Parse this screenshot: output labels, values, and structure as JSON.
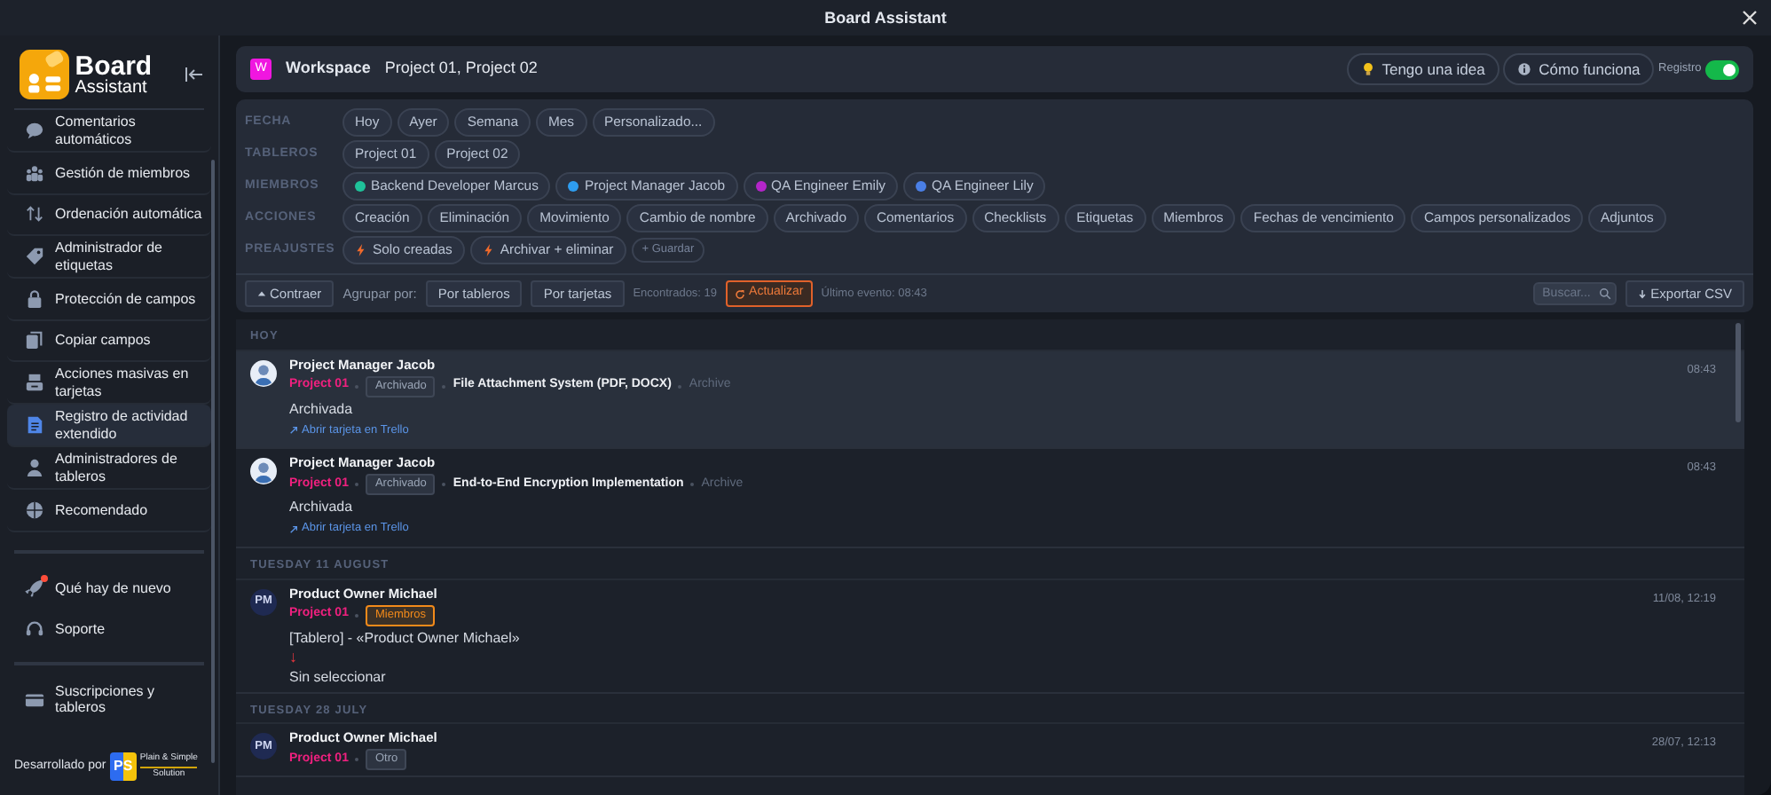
{
  "window": {
    "title": "Board Assistant"
  },
  "sidebar": {
    "logo_title": "Board",
    "logo_subtitle": "Assistant",
    "items": [
      {
        "label": "Comentarios automáticos",
        "selected": false
      },
      {
        "label": "Gestión de miembros",
        "selected": false
      },
      {
        "label": "Ordenación automática",
        "selected": false
      },
      {
        "label": "Administrador de etiquetas",
        "selected": false
      },
      {
        "label": "Protección de campos",
        "selected": false
      },
      {
        "label": "Copiar campos",
        "selected": false
      },
      {
        "label": "Acciones masivas en tarjetas",
        "selected": false
      },
      {
        "label": "Registro de actividad extendido",
        "selected": true
      },
      {
        "label": "Administradores de tableros",
        "selected": false
      },
      {
        "label": "Recomendado",
        "selected": false
      }
    ],
    "extra_items": [
      {
        "label": "Qué hay de nuevo",
        "notification": true
      },
      {
        "label": "Soporte",
        "notification": false
      }
    ],
    "footer_items": [
      {
        "label": "Suscripciones y tableros"
      }
    ],
    "credit": {
      "label": "Desarrollado por",
      "logo_mark": "PS",
      "company_line1": "Plain & Simple",
      "company_line2": "Solution"
    }
  },
  "header": {
    "workspace_initial": "W",
    "workspace_label": "Workspace",
    "boards": "Project 01, Project 02",
    "buttons": [
      {
        "label": "Tengo una idea",
        "kind": "idea"
      },
      {
        "label": "Cómo funciona",
        "kind": "info"
      }
    ],
    "toggle": {
      "label": "Registro",
      "on": true
    }
  },
  "filters": [
    {
      "label": "FECHA",
      "chips": [
        {
          "label": "Hoy",
          "kind": "plain"
        },
        {
          "label": "Ayer",
          "kind": "plain"
        },
        {
          "label": "Semana",
          "kind": "plain"
        },
        {
          "label": "Mes",
          "kind": "plain"
        },
        {
          "label": "Personalizado...",
          "kind": "plain"
        }
      ]
    },
    {
      "label": "TABLEROS",
      "chips": [
        {
          "label": "Project 01",
          "kind": "plain"
        },
        {
          "label": "Project 02",
          "kind": "plain"
        }
      ]
    },
    {
      "label": "MIEMBROS",
      "chips": [
        {
          "label": "Backend Developer Marcus",
          "kind": "member",
          "color": "#1fc29a"
        },
        {
          "label": "Project Manager Jacob",
          "kind": "member",
          "color": "#2e9df0"
        },
        {
          "label": "QA Engineer Emily",
          "kind": "member",
          "color": "#b325c9"
        },
        {
          "label": "QA Engineer Lily",
          "kind": "member",
          "color": "#4a7fe6"
        }
      ]
    },
    {
      "label": "ACCIONES",
      "chips": [
        {
          "label": "Creación",
          "kind": "plain"
        },
        {
          "label": "Eliminación",
          "kind": "plain"
        },
        {
          "label": "Movimiento",
          "kind": "plain"
        },
        {
          "label": "Cambio de nombre",
          "kind": "plain"
        },
        {
          "label": "Archivado",
          "kind": "plain"
        },
        {
          "label": "Comentarios",
          "kind": "plain"
        },
        {
          "label": "Checklists",
          "kind": "plain"
        },
        {
          "label": "Etiquetas",
          "kind": "plain"
        },
        {
          "label": "Miembros",
          "kind": "plain"
        },
        {
          "label": "Fechas de vencimiento",
          "kind": "plain"
        },
        {
          "label": "Campos personalizados",
          "kind": "plain"
        },
        {
          "label": "Adjuntos",
          "kind": "plain"
        }
      ]
    },
    {
      "label": "PREAJUSTES",
      "chips": [
        {
          "label": "Solo creadas",
          "kind": "preset"
        },
        {
          "label": "Archivar + eliminar",
          "kind": "preset"
        },
        {
          "label": "+ Guardar",
          "kind": "save"
        }
      ]
    }
  ],
  "toolbar": {
    "collapse": "Contraer",
    "group_label": "Agrupar por:",
    "group_options": [
      {
        "label": "Por tableros",
        "selected": false
      },
      {
        "label": "Por tarjetas",
        "selected": false
      }
    ],
    "found": "Encontrados: 19",
    "refresh": "Actualizar",
    "last_event": "Último evento: 08:43",
    "search_placeholder": "Buscar...",
    "export": "Exportar CSV"
  },
  "feed": [
    {
      "heading": "HOY",
      "events": [
        {
          "author": "Project Manager Jacob",
          "board": "Project 01",
          "tag": {
            "label": "Archivado"
          },
          "card": "File Attachment System (PDF, DOCX)",
          "card_state": "Archive",
          "lines": [
            {
              "text": "Archivada",
              "kind": "text"
            }
          ],
          "link": "Abrir tarjeta en Trello",
          "time": "08:43",
          "highlighted": true
        },
        {
          "author": "Project Manager Jacob",
          "board": "Project 01",
          "tag": {
            "label": "Archivado"
          },
          "card": "End-to-End Encryption Implementation",
          "card_state": "Archive",
          "lines": [
            {
              "text": "Archivada",
              "kind": "text"
            }
          ],
          "link": "Abrir tarjeta en Trello",
          "time": "08:43",
          "highlighted": false
        }
      ]
    },
    {
      "heading": "TUESDAY 11 AUGUST",
      "events": [
        {
          "author": "Product Owner Michael",
          "initials": "PM",
          "board": "Project 01",
          "tag": {
            "label": "Miembros",
            "color": "#f28a1a"
          },
          "lines": [
            {
              "text": "[Tablero] - «Product Owner Michael»",
              "kind": "text"
            },
            {
              "text": "↓",
              "kind": "arrow"
            },
            {
              "text": "Sin seleccionar",
              "kind": "text"
            }
          ],
          "time": "11/08, 12:19",
          "highlighted": false
        }
      ]
    },
    {
      "heading": "TUESDAY 28 JULY",
      "events": [
        {
          "author": "Product Owner Michael",
          "initials": "PM",
          "board": "Project 01",
          "tag": {
            "label": "Otro"
          },
          "time": "28/07, 12:13",
          "highlighted": false
        }
      ]
    }
  ]
}
